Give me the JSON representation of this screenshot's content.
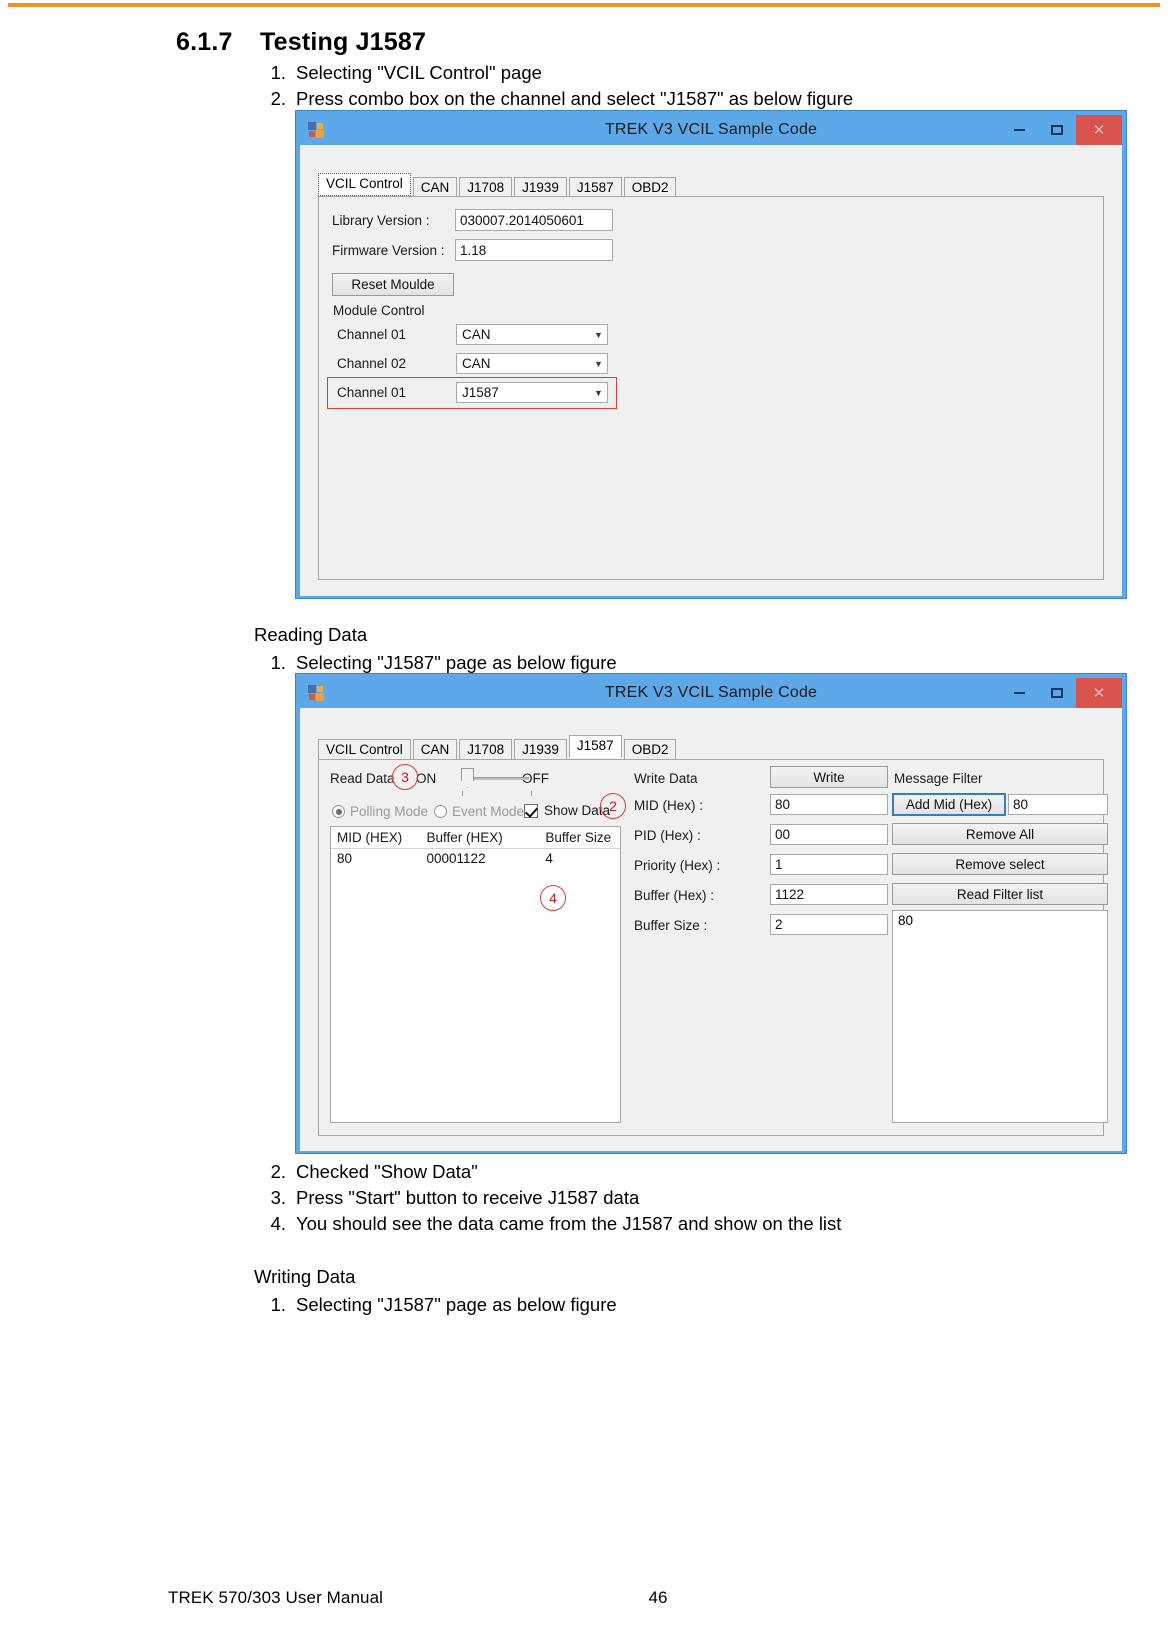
{
  "footer": {
    "title": "TREK 570/303 User Manual",
    "page": "46"
  },
  "section": {
    "number": "6.1.7",
    "title": "Testing J1587"
  },
  "intro_steps": [
    {
      "marker": "1.",
      "text": "Selecting \"VCIL Control\" page"
    },
    {
      "marker": "2.",
      "text": "Press combo box on the channel and select \"J1587\" as below figure"
    }
  ],
  "reading": {
    "heading": "Reading Data",
    "steps_before": [
      {
        "marker": "1.",
        "text": "Selecting \"J1587\" page as below figure"
      }
    ],
    "steps_after": [
      {
        "marker": "2.",
        "text": "Checked \"Show Data\""
      },
      {
        "marker": "3.",
        "text": "Press \"Start\" button to receive J1587 data"
      },
      {
        "marker": "4.",
        "text": "You should see the data came from the J1587 and show on the list"
      }
    ]
  },
  "writing": {
    "heading": "Writing Data",
    "steps": [
      {
        "marker": "1.",
        "text": "Selecting \"J1587\" page as below figure"
      }
    ]
  },
  "window1": {
    "title": "TREK V3 VCIL Sample Code",
    "buttons": {
      "minimize": "–",
      "maximize": "□",
      "close": "✕"
    },
    "tabs": [
      {
        "label": "VCIL Control",
        "selected": true
      },
      {
        "label": "CAN",
        "selected": false
      },
      {
        "label": "J1708",
        "selected": false
      },
      {
        "label": "J1939",
        "selected": false
      },
      {
        "label": "J1587",
        "selected": false
      },
      {
        "label": "OBD2",
        "selected": false
      }
    ],
    "fields": {
      "library_version_label": "Library Version :",
      "library_version_value": "030007.2014050601",
      "firmware_version_label": "Firmware Version :",
      "firmware_version_value": "1.18",
      "reset_button": "Reset Moulde",
      "module_control_label": "Module Control",
      "channel1_label": "Channel 01",
      "channel1_value": "CAN",
      "channel2_label": "Channel 02",
      "channel2_value": "CAN",
      "channel3_label": "Channel 01",
      "channel3_value": "J1587"
    },
    "highlight_color": "#E03A3A"
  },
  "window2": {
    "title": "TREK V3 VCIL Sample Code",
    "buttons": {
      "minimize": "–",
      "maximize": "□",
      "close": "✕"
    },
    "tabs": [
      {
        "label": "VCIL Control",
        "selected": false
      },
      {
        "label": "CAN",
        "selected": false
      },
      {
        "label": "J1708",
        "selected": false
      },
      {
        "label": "J1939",
        "selected": false
      },
      {
        "label": "J1587",
        "selected": true
      },
      {
        "label": "OBD2",
        "selected": false
      }
    ],
    "read_data": {
      "group_label": "Read Data",
      "on_label": "ON",
      "off_label": "OFF",
      "polling_mode": "Polling Mode",
      "event_mode": "Event Mode",
      "show_data": "Show Data",
      "grid_headers": [
        "MID (HEX)",
        "Buffer (HEX)",
        "Buffer Size"
      ],
      "grid_rows": [
        {
          "mid": "80",
          "buffer": "00001122",
          "size": "4"
        }
      ]
    },
    "write_data": {
      "group_label": "Write Data",
      "write_button": "Write",
      "mid_label": "MID (Hex) :",
      "mid_value": "80",
      "pid_label": "PID (Hex) :",
      "pid_value": "00",
      "priority_label": "Priority (Hex) :",
      "priority_value": "1",
      "buffer_label": "Buffer (Hex) :",
      "buffer_value": "1122",
      "buffer_size_label": "Buffer Size :",
      "buffer_size_value": "2"
    },
    "message_filter": {
      "group_label": "Message Filter",
      "add_mid_button": "Add Mid (Hex)",
      "add_mid_value": "80",
      "remove_all_button": "Remove All",
      "remove_select_button": "Remove select",
      "read_filter_list_button": "Read Filter list",
      "filter_list": [
        "80"
      ]
    },
    "callouts": [
      {
        "id": "2",
        "value": "2"
      },
      {
        "id": "3",
        "value": "3"
      },
      {
        "id": "4",
        "value": "4"
      }
    ]
  }
}
